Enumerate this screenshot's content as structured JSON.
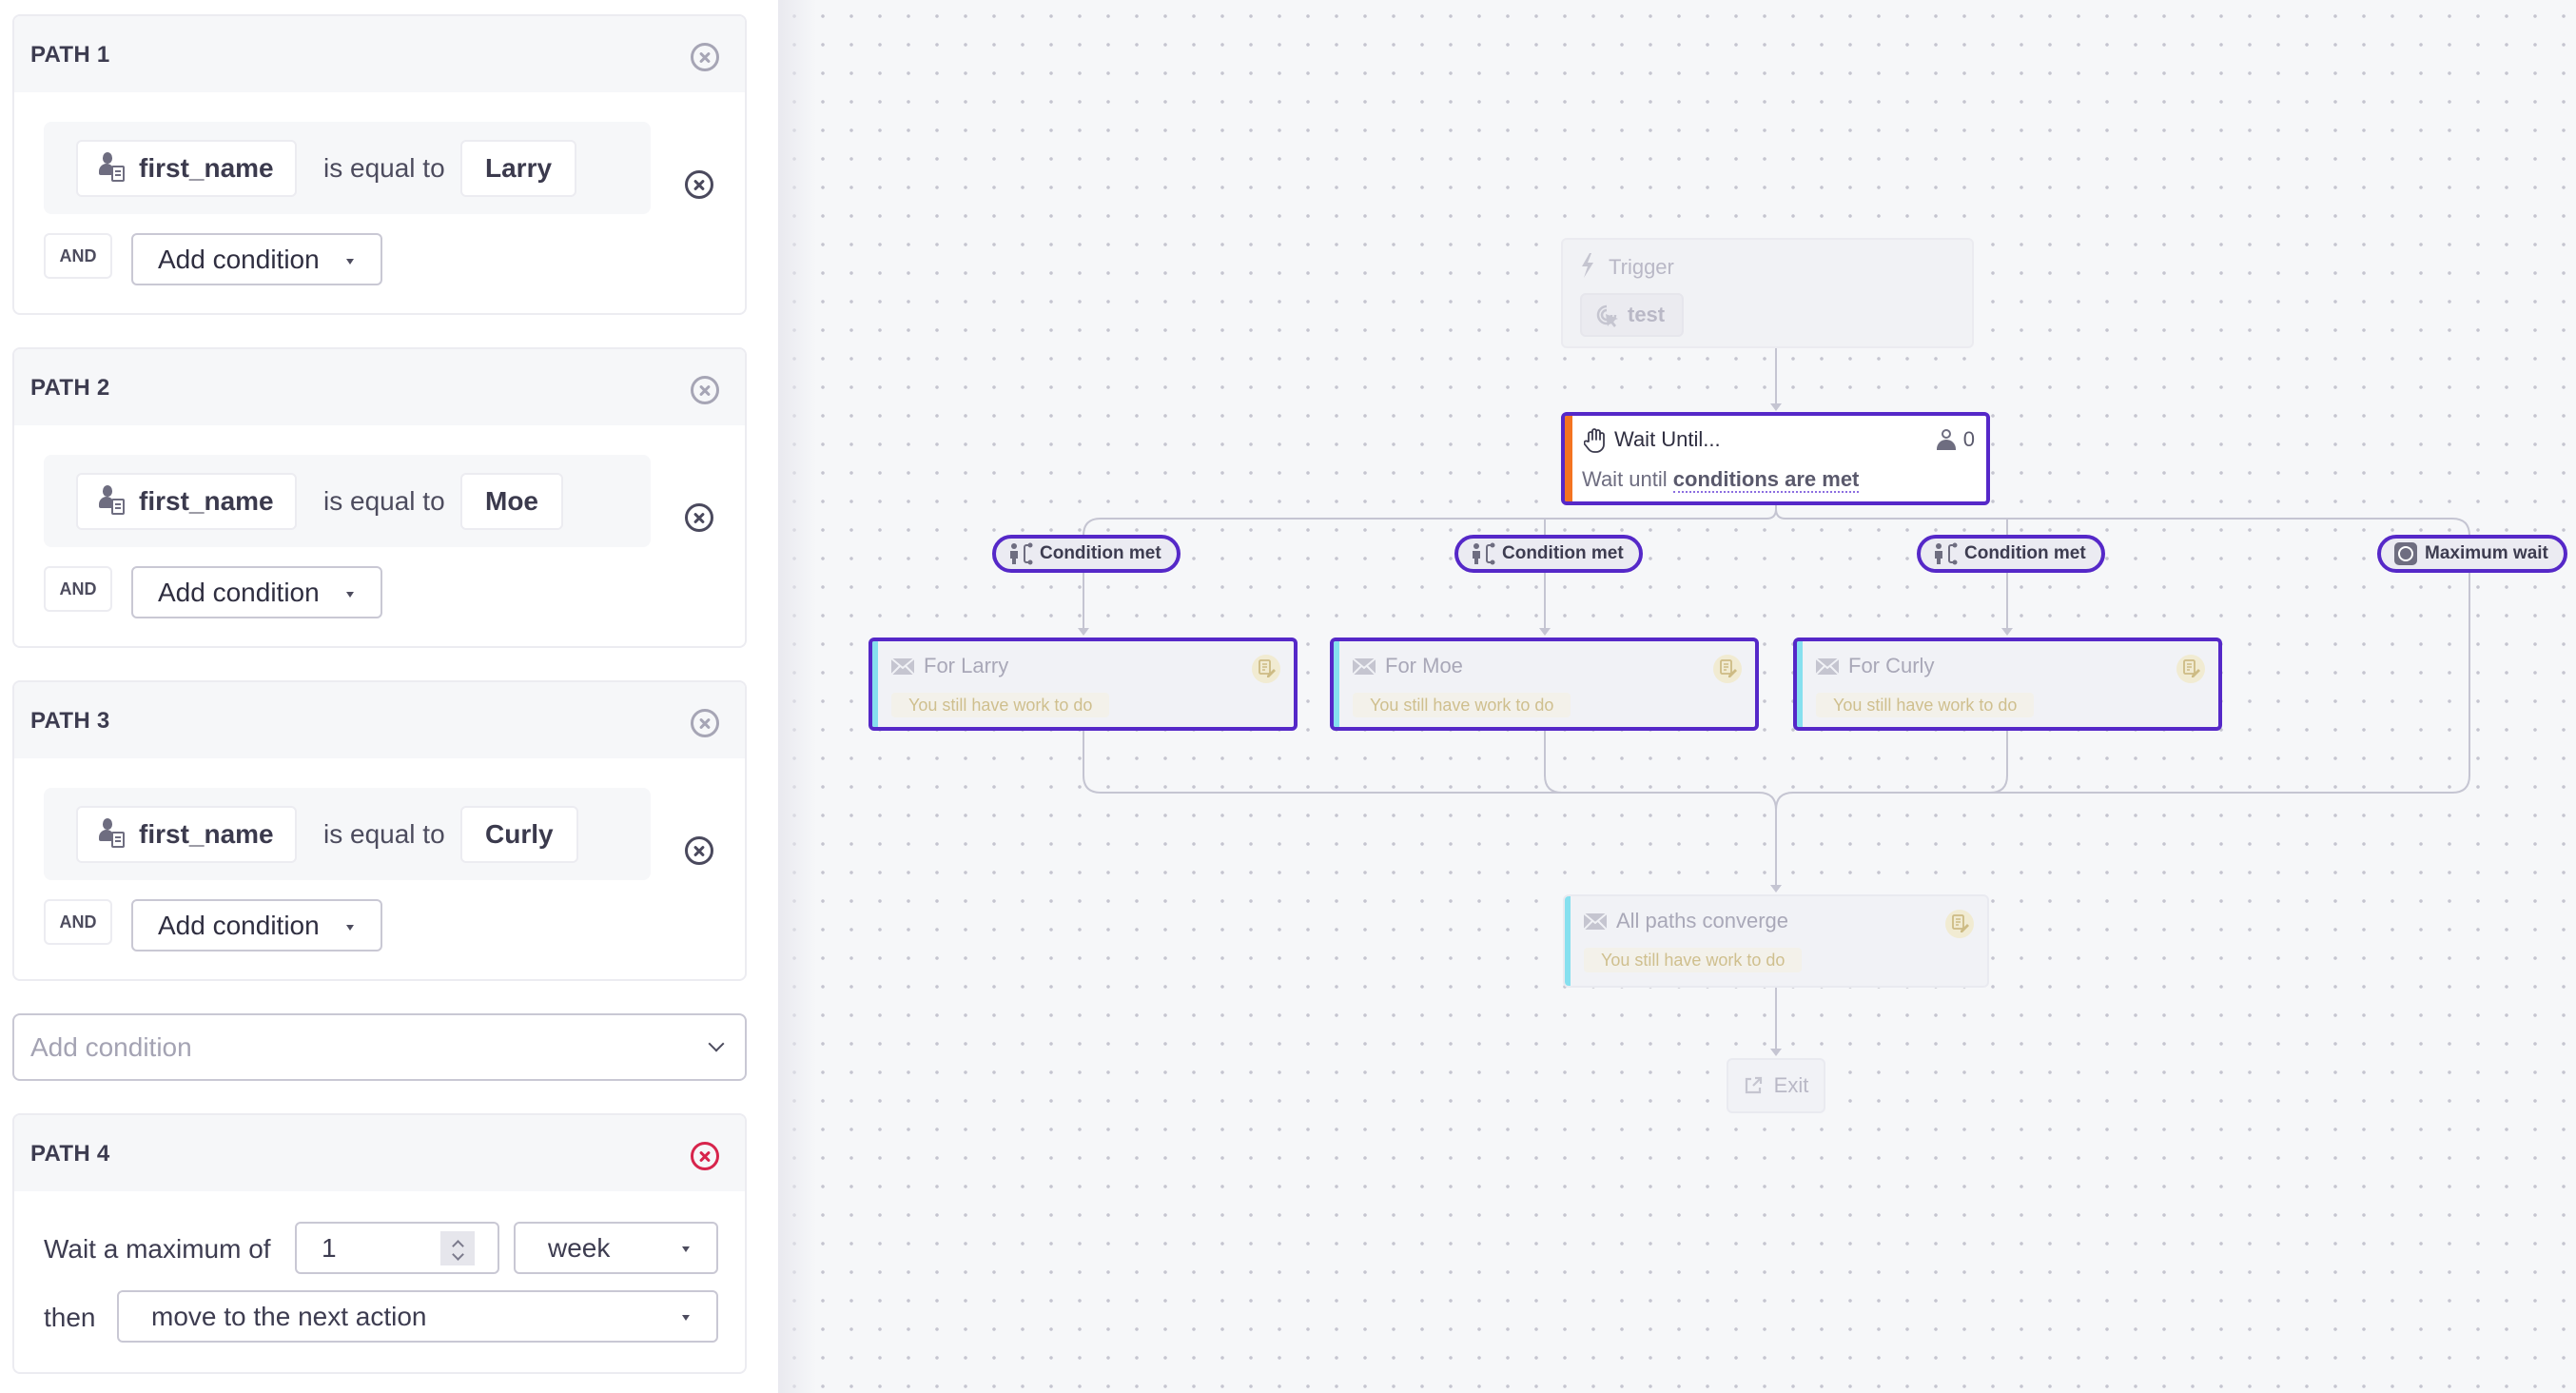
{
  "paths": [
    {
      "title": "PATH 1",
      "condition": {
        "field": "first_name",
        "operator": "is equal to",
        "value": "Larry"
      },
      "and_label": "AND",
      "add_condition_label": "Add condition"
    },
    {
      "title": "PATH 2",
      "condition": {
        "field": "first_name",
        "operator": "is equal to",
        "value": "Moe"
      },
      "and_label": "AND",
      "add_condition_label": "Add condition"
    },
    {
      "title": "PATH 3",
      "condition": {
        "field": "first_name",
        "operator": "is equal to",
        "value": "Curly"
      },
      "and_label": "AND",
      "add_condition_label": "Add condition"
    }
  ],
  "add_condition_select": {
    "placeholder": "Add condition"
  },
  "path4": {
    "title": "PATH 4",
    "wait_label": "Wait a maximum of",
    "wait_value": "1",
    "unit_value": "week",
    "then_label": "then",
    "then_value": "move to the next action"
  },
  "canvas": {
    "trigger": {
      "title": "Trigger",
      "event": "test"
    },
    "wait_until": {
      "title": "Wait Until...",
      "count": "0",
      "desc_prefix": "Wait until",
      "desc_link": "conditions are met"
    },
    "branches": [
      {
        "pill": "Condition met",
        "pill_icon": "branch-person-icon",
        "node_title": "For Larry",
        "status": "You still have work to do"
      },
      {
        "pill": "Condition met",
        "pill_icon": "branch-person-icon",
        "node_title": "For Moe",
        "status": "You still have work to do"
      },
      {
        "pill": "Condition met",
        "pill_icon": "branch-person-icon",
        "node_title": "For Curly",
        "status": "You still have work to do"
      },
      {
        "pill": "Maximum wait",
        "pill_icon": "clock-icon"
      }
    ],
    "converge": {
      "title": "All paths converge",
      "status": "You still have work to do"
    },
    "exit": {
      "label": "Exit"
    }
  },
  "colors": {
    "accent": "#5528c8",
    "wait_stripe": "#f47421",
    "email_stripe": "#86e0ef",
    "danger": "#d7244c",
    "todo_text": "#cfbf8e"
  }
}
